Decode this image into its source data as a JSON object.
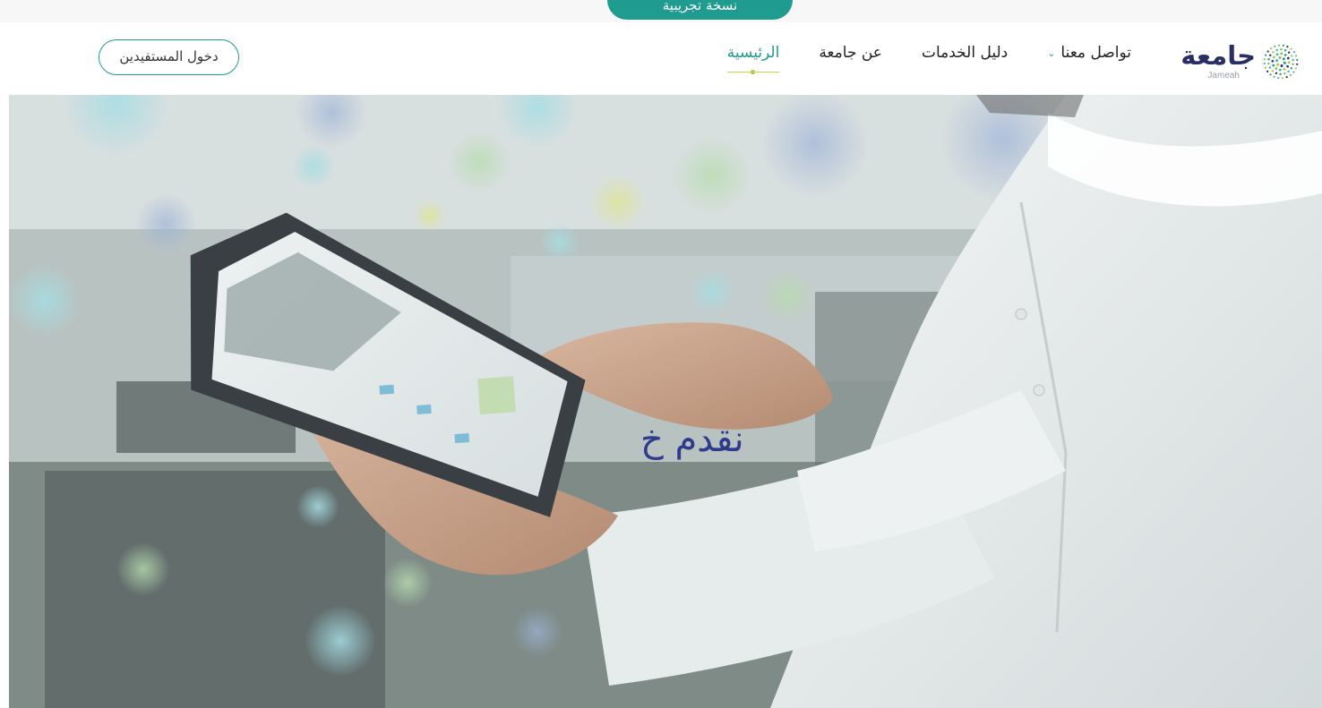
{
  "banner": {
    "label": "نسخة تجريبية"
  },
  "brand": {
    "name": "جامعة",
    "latin": "Jameah",
    "logo_icon": "dotted-circle-logo"
  },
  "nav": {
    "items": [
      {
        "label": "الرئيسية",
        "active": true
      },
      {
        "label": "عن جامعة",
        "active": false
      },
      {
        "label": "دليل الخدمات",
        "active": false
      },
      {
        "label": "تواصل معنا",
        "active": false,
        "dropdown": true
      }
    ],
    "dropdown_icon": "chevron-down-icon"
  },
  "login": {
    "label": "دخول المستفيدين"
  },
  "hero": {
    "headline": "نقدم خ"
  },
  "colors": {
    "accent": "#1f9b8f",
    "headline": "#2f3a8c",
    "brand_text": "#2a2f63",
    "underline": "#c9d64a"
  }
}
